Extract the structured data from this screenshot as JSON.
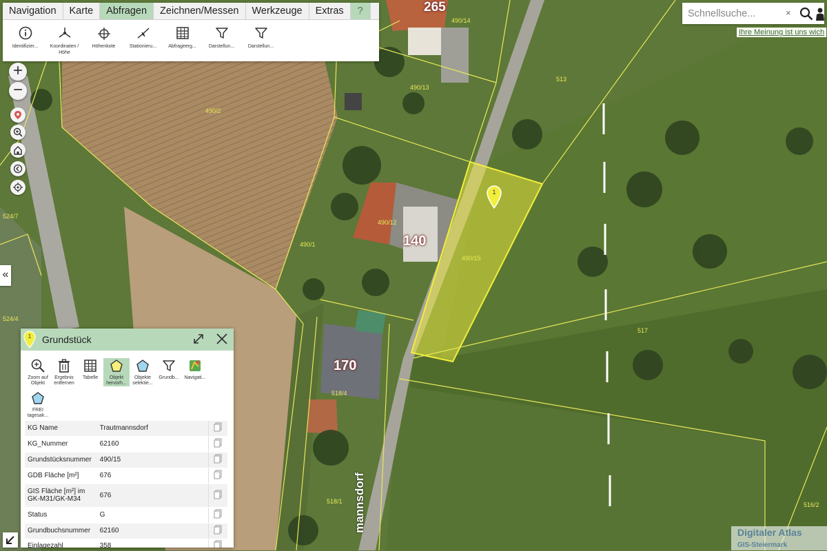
{
  "menu": {
    "tabs": [
      {
        "label": "Navigation"
      },
      {
        "label": "Karte"
      },
      {
        "label": "Abfragen"
      },
      {
        "label": "Zeichnen/Messen"
      },
      {
        "label": "Werkzeuge"
      },
      {
        "label": "Extras"
      },
      {
        "label": "?"
      }
    ],
    "active_tab": "Abfragen"
  },
  "tools": [
    {
      "label": "Identifizier...",
      "icon": "info-icon"
    },
    {
      "label": "Koordinaten / Höhe",
      "icon": "coordinates-icon"
    },
    {
      "label": "Höhenkote",
      "icon": "elevation-point-icon"
    },
    {
      "label": "Stationieru...",
      "icon": "stationing-icon"
    },
    {
      "label": "Abfrageerg...",
      "icon": "table-icon"
    },
    {
      "label": "Darstellun...",
      "icon": "filter-icon"
    },
    {
      "label": "Darstellun...",
      "icon": "filter-icon"
    }
  ],
  "search": {
    "placeholder": "Schnellsuche...",
    "clear": "×"
  },
  "feedback_link": "Ihre Meinung ist uns wich",
  "map_controls": {
    "zoom_in": "+",
    "zoom_out": "−",
    "collapse": "«"
  },
  "map_labels": {
    "house_numbers": [
      "265",
      "140",
      "170"
    ],
    "street_name": "mannsdorf",
    "parcel_labels": [
      "490/14",
      "490/13",
      "490/2",
      "513",
      "490/12",
      "490/1",
      "490/15",
      "517",
      "524/7",
      "524/4",
      "518/4",
      "518/1",
      "516/2"
    ],
    "marker_label": "1"
  },
  "panel": {
    "title": "Grundstück",
    "marker_label": "1",
    "tools": [
      {
        "label": "Zoom auf Objekt",
        "icon": "zoom-to-object-icon"
      },
      {
        "label": "Ergebnis entfernen",
        "icon": "trash-icon"
      },
      {
        "label": "Tabelle",
        "icon": "table-icon"
      },
      {
        "label": "Objekt hervorh...",
        "icon": "highlight-polygon-icon"
      },
      {
        "label": "Objekte selektie...",
        "icon": "select-polygon-icon"
      },
      {
        "label": "Grundb...",
        "icon": "filter-icon"
      },
      {
        "label": "Navigati...",
        "icon": "navigation-icon"
      },
      {
        "label": "FREI tagesak...",
        "icon": "polygon-icon"
      }
    ],
    "rows": [
      {
        "key": "KG Name",
        "value": "Trautmannsdorf"
      },
      {
        "key": "KG_Nummer",
        "value": "62160"
      },
      {
        "key": "Grundstücksnummer",
        "value": "490/15"
      },
      {
        "key": "GDB Fläche [m²]",
        "value": "676"
      },
      {
        "key": "GIS Fläche [m²] im GK-M31/GK-M34",
        "value": "676"
      },
      {
        "key": "Status",
        "value": "G"
      },
      {
        "key": "Grundbuchsnummer",
        "value": "62160"
      },
      {
        "key": "Einlagezahl",
        "value": "358"
      }
    ]
  },
  "branding": {
    "title": "Digitaler Atlas",
    "subtitle": "GIS-Steiermark"
  },
  "colors": {
    "accent": "#b7d9ba",
    "parcel_line": "#e8e85a",
    "highlight": "#f2ee3c"
  }
}
